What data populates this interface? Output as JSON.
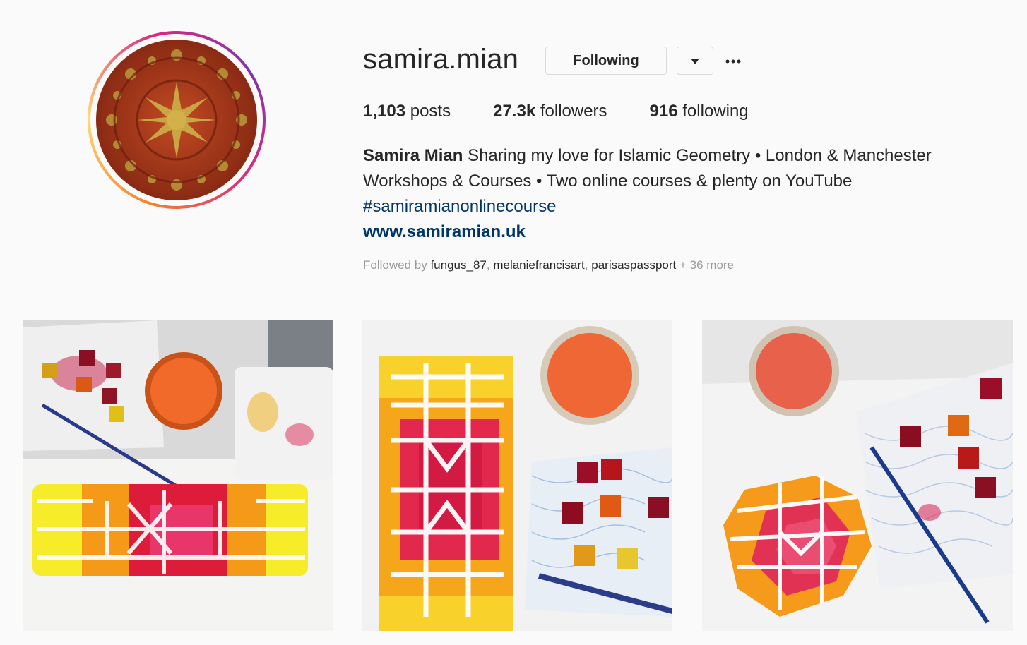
{
  "profile": {
    "username": "samira.mian",
    "follow_button_label": "Following",
    "stats": {
      "posts_count": "1,103",
      "posts_label": "posts",
      "followers_count": "27.3k",
      "followers_label": "followers",
      "following_count": "916",
      "following_label": "following"
    },
    "bio": {
      "name": "Samira Mian",
      "line1": "Sharing my love for Islamic Geometry • London & Manchester",
      "line2": "Workshops & Courses • Two online courses & plenty on YouTube",
      "hashtag": "#samiramianonlinecourse",
      "website": "www.samiramian.uk"
    },
    "followed_by": {
      "prefix": "Followed by",
      "users": [
        "fungus_87",
        "melaniefrancisart",
        "parisaspassport"
      ],
      "sep": ",",
      "more": "+ 36 more"
    }
  },
  "icons": {
    "dropdown": "caret-down-icon",
    "more": "ellipsis-icon"
  },
  "colors": {
    "link": "#003569",
    "muted": "#999999",
    "border": "#dbdbdb",
    "background": "#fafafa"
  }
}
